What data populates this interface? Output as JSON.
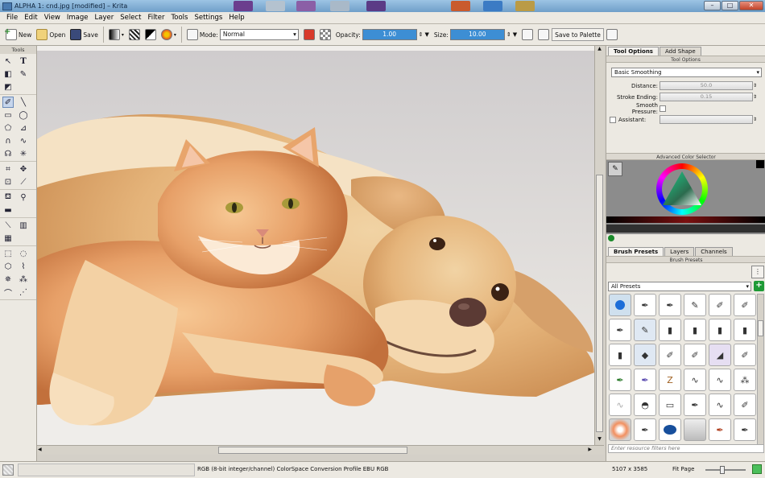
{
  "window": {
    "title": "ALPHA 1: cnd.jpg [modified] – Krita",
    "minimize": "–",
    "maximize": "□",
    "close": "✕"
  },
  "menu": [
    "File",
    "Edit",
    "View",
    "Image",
    "Layer",
    "Select",
    "Filter",
    "Tools",
    "Settings",
    "Help"
  ],
  "toolbar": {
    "new_label": "New",
    "open_label": "Open",
    "save_label": "Save",
    "mode_label": "Mode:",
    "mode_value": "Normal",
    "opacity_label": "Opacity:",
    "opacity_value": "1.00",
    "size_label": "Size:",
    "size_value": "10.00",
    "save_palette_label": "Save to Palette"
  },
  "tools_panel": {
    "title": "Tools"
  },
  "tool_options": {
    "tabs": [
      "Tool Options",
      "Add Shape"
    ],
    "panel_title": "Tool Options",
    "smoothing_value": "Basic Smoothing",
    "distance_label": "Distance:",
    "distance_value": "50.0",
    "stroke_ending_label": "Stroke Ending:",
    "stroke_ending_value": "0.15",
    "smooth_pressure_label": "Smooth Pressure:",
    "assistant_label": "Assistant:"
  },
  "color_selector": {
    "title": "Advanced Color Selector"
  },
  "brush_presets": {
    "tabs": [
      "Brush Presets",
      "Layers",
      "Channels"
    ],
    "panel_title": "Brush Presets",
    "filter_value": "All Presets",
    "search_placeholder": "Enter resource filters here"
  },
  "statusbar": {
    "colorspace": "RGB (8-bit integer/channel)  ColorSpace Conversion Profile EBU RGB",
    "dimensions": "5107 x 3585",
    "zoom_label": "Fit Page"
  },
  "colors": {
    "accent": "#3d8ed4",
    "titlebar": "#7fa9d2",
    "canvas_bg": "#f0eeeb"
  }
}
